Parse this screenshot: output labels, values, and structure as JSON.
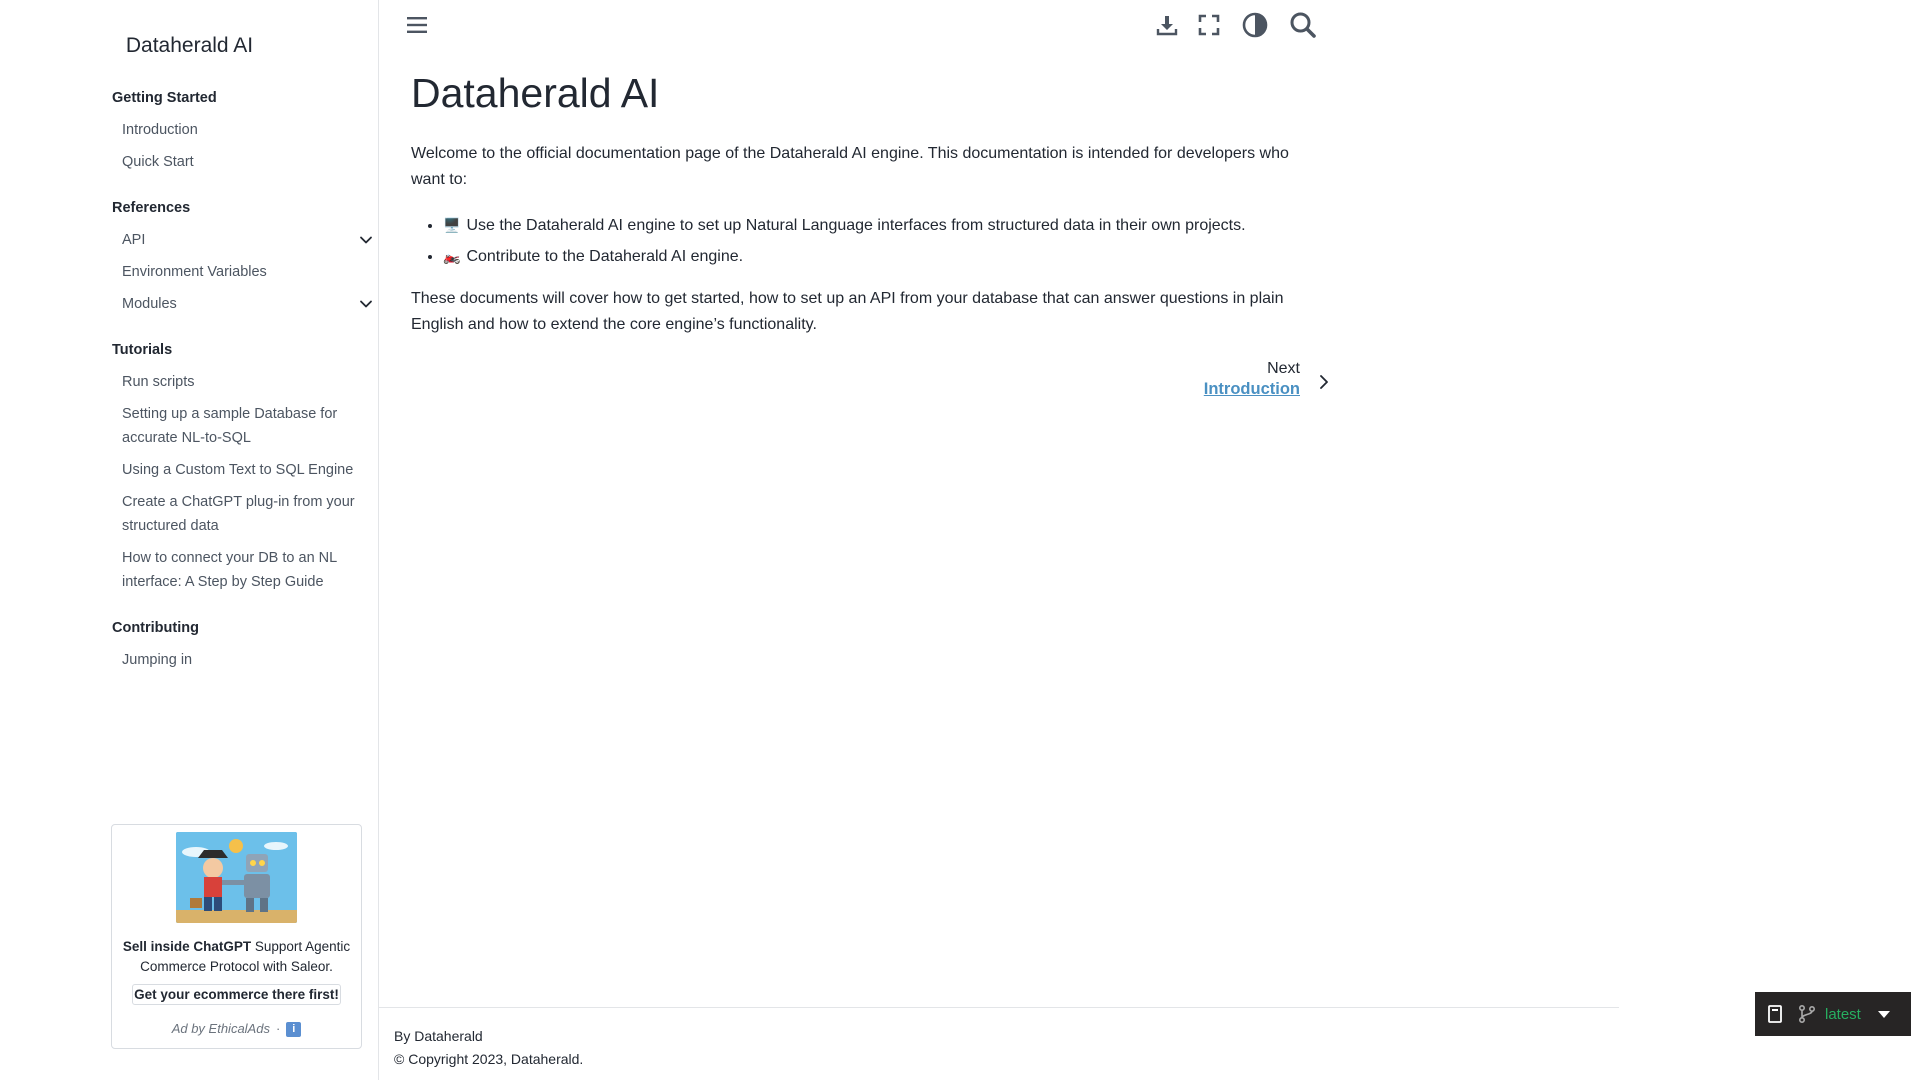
{
  "sidebar": {
    "brand": "Dataherald AI",
    "sections": [
      {
        "caption": "Getting Started",
        "items": [
          {
            "label": "Introduction"
          },
          {
            "label": "Quick Start"
          }
        ]
      },
      {
        "caption": "References",
        "items": [
          {
            "label": "API",
            "expandable": true
          },
          {
            "label": "Environment Variables"
          },
          {
            "label": "Modules",
            "expandable": true
          }
        ]
      },
      {
        "caption": "Tutorials",
        "items": [
          {
            "label": "Run scripts"
          },
          {
            "label": "Setting up a sample Database for accurate NL-to-SQL"
          },
          {
            "label": "Using a Custom Text to SQL Engine"
          },
          {
            "label": "Create a ChatGPT plug-in from your structured data"
          },
          {
            "label": "How to connect your DB to an NL interface: A Step by Step Guide"
          }
        ]
      },
      {
        "caption": "Contributing",
        "items": [
          {
            "label": "Jumping in"
          }
        ]
      }
    ]
  },
  "ad": {
    "headline": "Sell inside ChatGPT",
    "body": " Support Agentic Commerce Protocol with Saleor.",
    "cta": "Get your ecommerce there first!",
    "by": "Ad by EthicalAds",
    "separator": "·",
    "info": "i"
  },
  "toolbar": {
    "icons": [
      "menu-icon",
      "download-icon",
      "fullscreen-icon",
      "theme-toggle-icon",
      "search-icon"
    ]
  },
  "main": {
    "title": "Dataherald AI",
    "intro": "Welcome to the official documentation page of the Dataherald AI engine. This documentation is intended for developers who want to:",
    "bullets": [
      {
        "emoji": "🖥️",
        "text": "Use the Dataherald AI engine to set up Natural Language interfaces from structured data in their own projects."
      },
      {
        "emoji": "🏍️",
        "text": "Contribute to the Dataherald AI engine."
      }
    ],
    "outro": "These documents will cover how to get started, how to set up an API from your database that can answer questions in plain English and how to extend the core engine’s functionality.",
    "next_label": "Next",
    "next_link": "Introduction"
  },
  "footer": {
    "by": "By Dataherald",
    "copyright": "© Copyright 2023, Dataherald."
  },
  "flyout": {
    "version": "latest"
  },
  "colors": {
    "link": "#4a90c2",
    "text": "#222832",
    "muted": "#4c5561",
    "flyout_bg": "#272525",
    "version_green": "#27ae60"
  }
}
